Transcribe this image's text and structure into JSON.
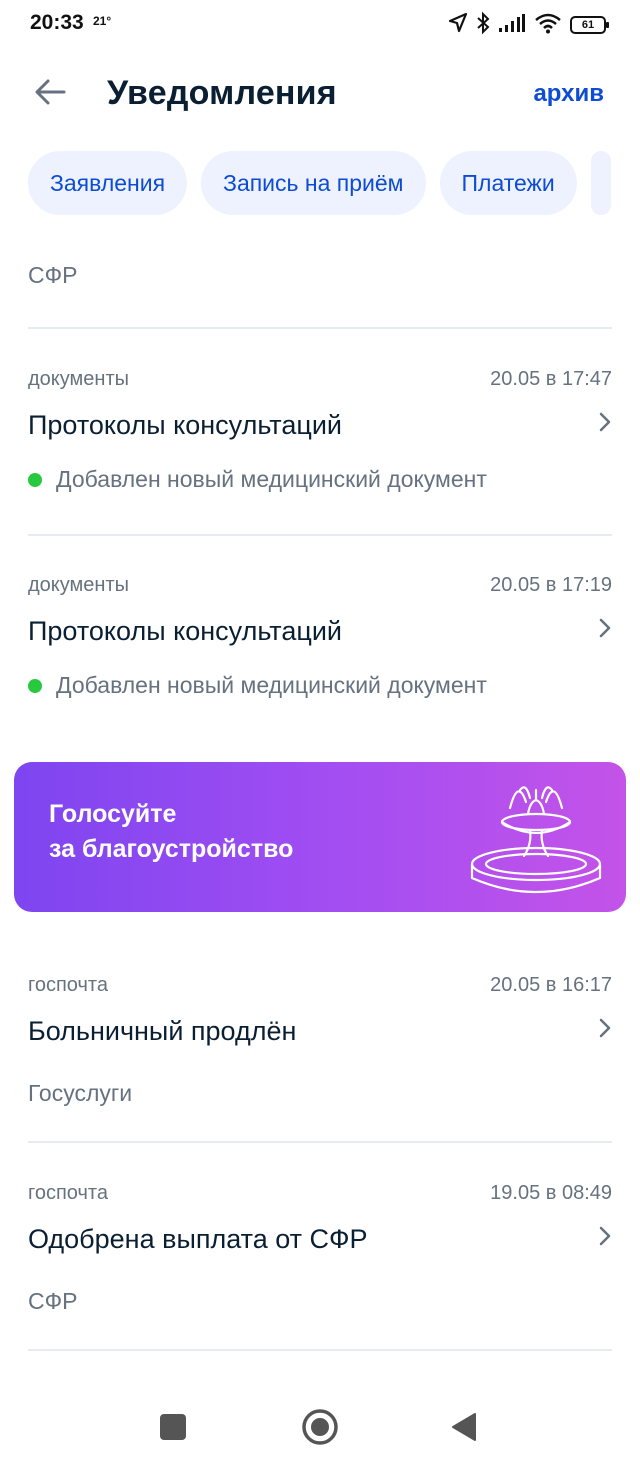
{
  "status_bar": {
    "time": "20:33",
    "temperature": "21°",
    "battery": "61"
  },
  "header": {
    "title": "Уведомления",
    "archive_label": "архив"
  },
  "chips": [
    {
      "label": "Заявления"
    },
    {
      "label": "Запись на приём"
    },
    {
      "label": "Платежи"
    }
  ],
  "top_item_sender": "СФР",
  "notifications": [
    {
      "category": "документы",
      "date": "20.05 в 17:47",
      "title": "Протоколы консультаций",
      "status": "Добавлен новый медицинский документ"
    },
    {
      "category": "документы",
      "date": "20.05 в 17:19",
      "title": "Протоколы консультаций",
      "status": "Добавлен новый медицинский документ"
    }
  ],
  "promo": {
    "line1": "Голосуйте",
    "line2": "за благоустройство"
  },
  "notifications_after": [
    {
      "category": "госпочта",
      "date": "20.05 в 16:17",
      "title": "Больничный продлён",
      "sender": "Госуслуги"
    },
    {
      "category": "госпочта",
      "date": "19.05 в 08:49",
      "title": "Одобрена выплата от СФР",
      "sender": "СФР"
    }
  ],
  "colors": {
    "accent": "#0d4cd3",
    "chip_bg": "#edf2fe",
    "secondary_text": "#66727f",
    "status_dot": "#28c93f",
    "promo_gradient_start": "#7e45f0",
    "promo_gradient_end": "#c453e8"
  },
  "icons": {
    "back": "arrow-left-icon",
    "chevron": "chevron-right-icon",
    "promo_art": "fountain-icon",
    "nav_recents": "square-icon",
    "nav_home": "circle-icon",
    "nav_back": "triangle-back-icon"
  }
}
